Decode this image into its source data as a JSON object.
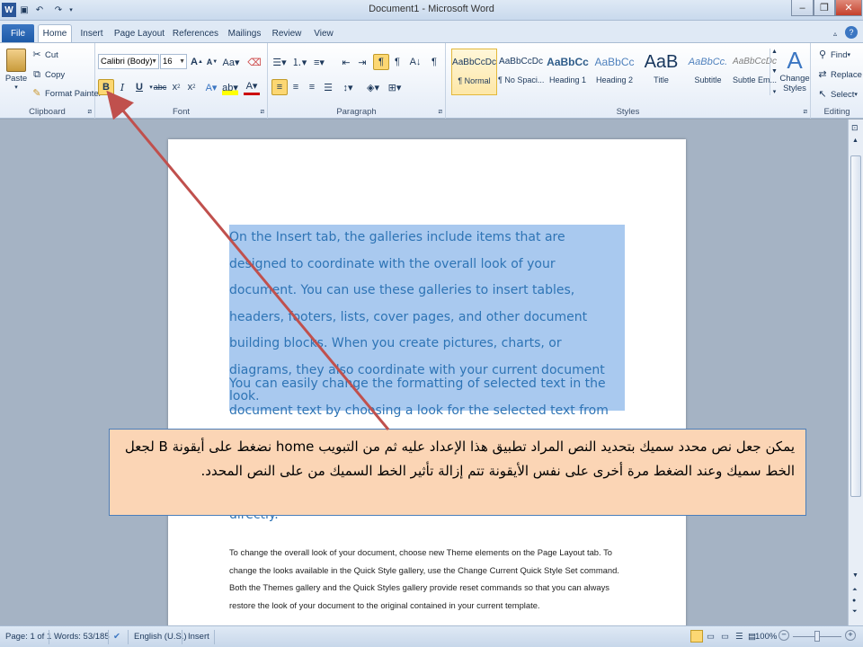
{
  "window": {
    "title": "Document1 - Microsoft Word"
  },
  "tabs": [
    "File",
    "Home",
    "Insert",
    "Page Layout",
    "References",
    "Mailings",
    "Review",
    "View"
  ],
  "clipboard": {
    "paste": "Paste",
    "cut": "Cut",
    "copy": "Copy",
    "format_painter": "Format Painter",
    "label": "Clipboard"
  },
  "font": {
    "name": "Calibri (Body)",
    "size": "16",
    "bold": "B",
    "italic": "I",
    "underline": "U",
    "label": "Font"
  },
  "paragraph": {
    "label": "Paragraph"
  },
  "styles": {
    "items": [
      {
        "sample": "AaBbCcDc",
        "name": "¶ Normal"
      },
      {
        "sample": "AaBbCcDc",
        "name": "¶ No Spaci..."
      },
      {
        "sample": "AaBbCc",
        "name": "Heading 1"
      },
      {
        "sample": "AaBbCc",
        "name": "Heading 2"
      },
      {
        "sample": "AaB",
        "name": "Title"
      },
      {
        "sample": "AaBbCc.",
        "name": "Subtitle"
      },
      {
        "sample": "AaBbCcDc",
        "name": "Subtle Em..."
      }
    ],
    "change_styles": "Change Styles",
    "label": "Styles"
  },
  "editing": {
    "find": "Find",
    "replace": "Replace",
    "select": "Select",
    "label": "Editing"
  },
  "document": {
    "selected_paragraph": "On the Insert tab, the galleries include items that are designed to coordinate with the overall look of your document. You can use these galleries to insert tables, headers, footers, lists, cover pages, and other document building blocks. When you create pictures, charts, or diagrams, they also coordinate with your current document look.",
    "paragraph2": "You can easily change the formatting of selected text in the document text by choosing a look for the selected text from the Quick Styles",
    "paragraph2_tail": "directly.",
    "paragraph3": "To change the overall look of your document, choose new Theme elements on the Page Layout tab. To change the looks available in the Quick Style gallery, use the Change Current Quick Style Set command. Both the Themes gallery and the Quick Styles gallery provide reset commands so that you can always restore the look of your document to the original contained in your current template."
  },
  "callout": {
    "text": "يمكن جعل نص محدد سميك بتحديد النص المراد تطبيق هذا الإعداد عليه ثم من التبويب home نضغط على أيقونة B لجعل الخط سميك وعند الضغط مرة أخرى على نفس الأيقونة تتم إزالة تأثير الخط السميك من على النص المحدد."
  },
  "status": {
    "page": "Page: 1 of 1",
    "words": "Words: 53/185",
    "language": "English (U.S.)",
    "mode": "Insert",
    "zoom": "100%"
  },
  "colors": {
    "accent": "#2e74b5",
    "selection": "#a9c9ef",
    "callout_fill": "#fbd5b5",
    "arrow": "#c0504d"
  }
}
